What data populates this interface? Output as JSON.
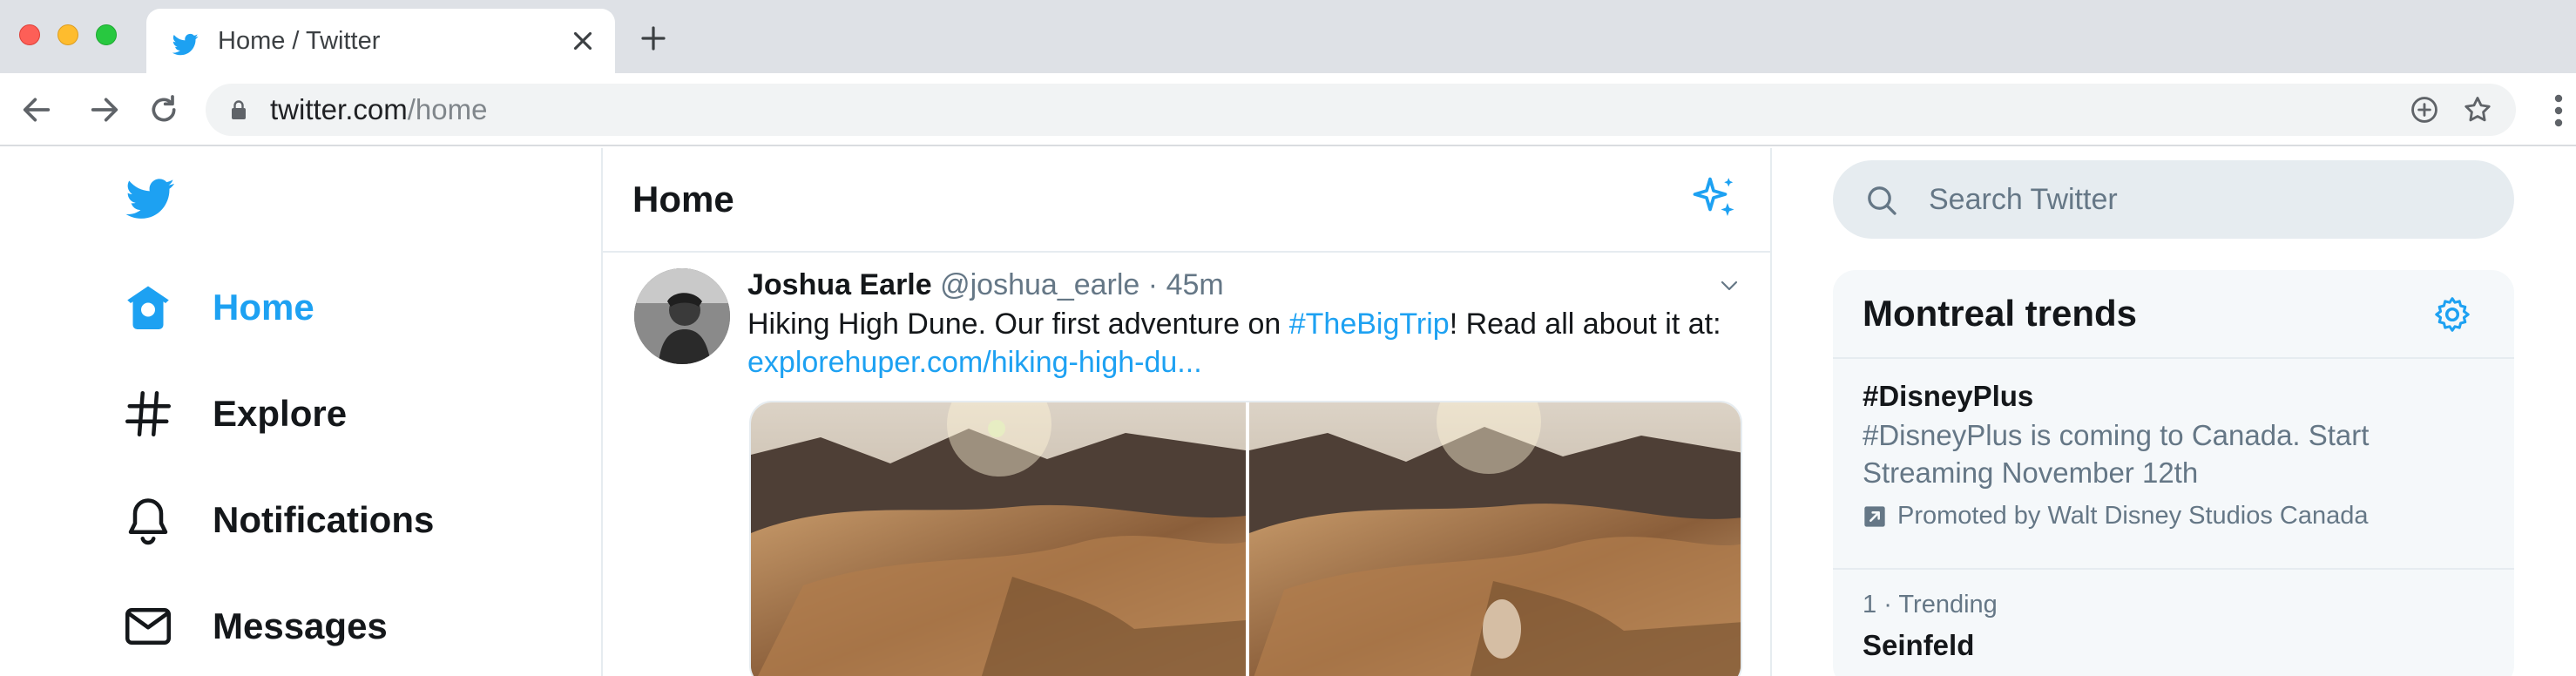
{
  "browser": {
    "tab_title": "Home / Twitter",
    "url_host": "twitter.com",
    "url_path": "/home"
  },
  "sidebar": {
    "items": [
      {
        "label": "Home",
        "icon": "home-icon",
        "active": true
      },
      {
        "label": "Explore",
        "icon": "hashtag-icon",
        "active": false
      },
      {
        "label": "Notifications",
        "icon": "bell-icon",
        "active": false
      },
      {
        "label": "Messages",
        "icon": "envelope-icon",
        "active": false
      }
    ]
  },
  "main": {
    "title": "Home"
  },
  "tweet": {
    "name": "Joshua Earle",
    "handle": "@joshua_earle",
    "separator": "·",
    "time": "45m",
    "text_before": "Hiking High Dune. Our first adventure on ",
    "hashtag": "#TheBigTrip",
    "text_after": "! Read all about it at:",
    "link": "explorehuper.com/hiking-high-du..."
  },
  "search": {
    "placeholder": "Search Twitter"
  },
  "trends": {
    "title": "Montreal trends",
    "items": [
      {
        "name": "#DisneyPlus",
        "description": "#DisneyPlus is coming to Canada. Start Streaming November 12th",
        "promoted": "Promoted by Walt Disney Studios Canada"
      },
      {
        "rank": "1",
        "separator": "·",
        "context": "Trending",
        "name": "Seinfeld"
      }
    ]
  },
  "colors": {
    "brand": "#1da1f2",
    "text": "#14171a",
    "muted": "#657786",
    "border": "#e6ecf0"
  }
}
